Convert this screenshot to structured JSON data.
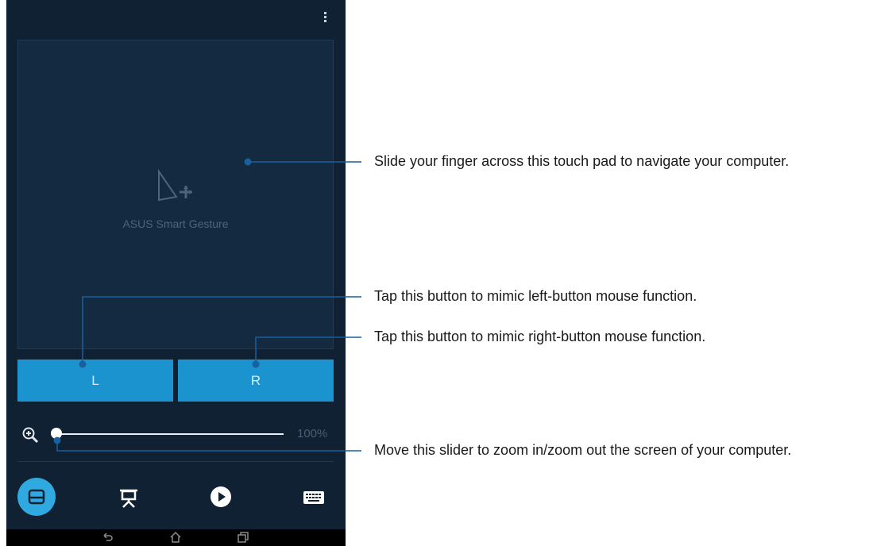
{
  "touchpad": {
    "label": "ASUS Smart Gesture"
  },
  "buttons": {
    "left": "L",
    "right": "R"
  },
  "zoom": {
    "value": "100%",
    "level": 0.0
  },
  "tabs": [
    {
      "name": "touchpad",
      "icon": "touchpad-icon",
      "active": true
    },
    {
      "name": "presentation",
      "icon": "presentation-icon",
      "active": false
    },
    {
      "name": "media",
      "icon": "play-icon",
      "active": false
    },
    {
      "name": "keyboard",
      "icon": "keyboard-icon",
      "active": false
    }
  ],
  "annotations": {
    "touchpad": "Slide your finger across this touch pad to navigate your computer.",
    "left_button": "Tap this button to mimic left-button mouse function.",
    "right_button": "Tap this button to mimic right-button mouse function.",
    "slider": "Move this slider to zoom in/zoom out the screen of your computer."
  },
  "colors": {
    "background": "#0f2133",
    "accent": "#1a93cf",
    "active_tab": "#2fa9e0",
    "leader_line": "#1a5f9e"
  }
}
